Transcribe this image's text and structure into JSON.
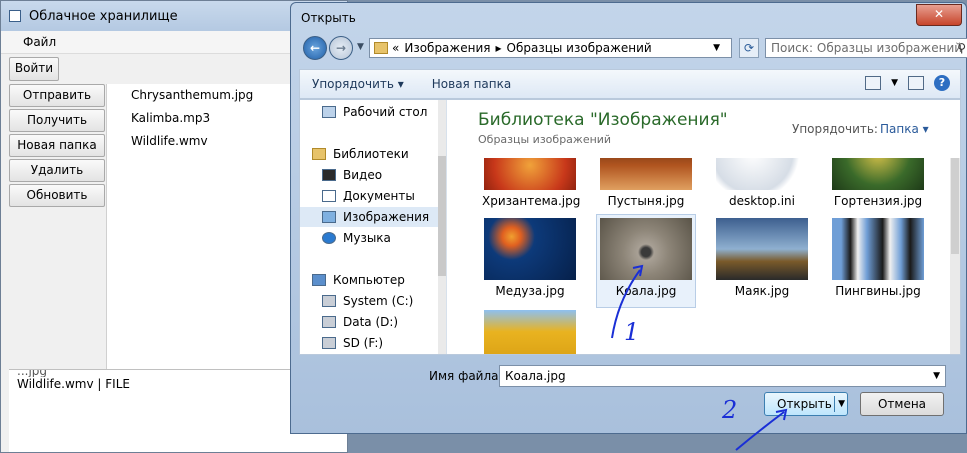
{
  "app": {
    "title": "Облачное хранилище",
    "menu": "Файл",
    "login": "Войти",
    "buttons": [
      "Отправить",
      "Получить",
      "Новая папка",
      "Удалить",
      "Обновить"
    ],
    "files": [
      "Chrysanthemum.jpg",
      "Kalimba.mp3",
      "Wildlife.wmv"
    ],
    "log_partial": "...jpg",
    "log_line": "Wildlife.wmv | FILE"
  },
  "dialog": {
    "title": "Открыть",
    "close_glyph": "✕",
    "path": {
      "prefix": "«",
      "parts": [
        "Изображения",
        "Образцы изображений"
      ],
      "sep": "▸"
    },
    "search_placeholder": "Поиск: Образцы изображений",
    "toolbar": {
      "organize": "Упорядочить ▾",
      "new_folder": "Новая папка",
      "help": "?"
    },
    "nav": [
      {
        "label": "Рабочий стол",
        "icon": "desktop-icon"
      },
      {
        "label": "Библиотеки",
        "icon": "libraries-icon"
      },
      {
        "label": "Видео",
        "icon": "video-icon"
      },
      {
        "label": "Документы",
        "icon": "documents-icon"
      },
      {
        "label": "Изображения",
        "icon": "pictures-icon",
        "selected": true
      },
      {
        "label": "Музыка",
        "icon": "music-icon"
      },
      {
        "label": "Компьютер",
        "icon": "computer-icon"
      },
      {
        "label": "System (C:)",
        "icon": "drive-icon"
      },
      {
        "label": "Data (D:)",
        "icon": "drive-icon"
      },
      {
        "label": "SD (F:)",
        "icon": "drive-icon"
      }
    ],
    "library_title": "Библиотека \"Изображения\"",
    "library_subtitle": "Образцы изображений",
    "arrange_label": "Упорядочить:",
    "arrange_value": "Папка ▾",
    "thumbnails": [
      {
        "label": "Хризантема.jpg",
        "color": "#c8381a"
      },
      {
        "label": "Пустыня.jpg",
        "color": "#b0541f"
      },
      {
        "label": "desktop.ini",
        "color": "#e4e8ee"
      },
      {
        "label": "Гортензия.jpg",
        "color": "#3a6a2a"
      },
      {
        "label": "Медуза.jpg",
        "color": "#0d3a7a"
      },
      {
        "label": "Коала.jpg",
        "color": "#8d8578",
        "selected": true
      },
      {
        "label": "Маяк.jpg",
        "color": "#3d5f8f"
      },
      {
        "label": "Пингвины.jpg",
        "color": "#6f9ed6"
      },
      {
        "label": "",
        "color": "#e9b320"
      }
    ],
    "filename_label": "Имя файла:",
    "filename_value": "Коала.jpg",
    "open_label": "Открыть",
    "cancel_label": "Отмена"
  },
  "annotations": [
    "1",
    "2"
  ]
}
